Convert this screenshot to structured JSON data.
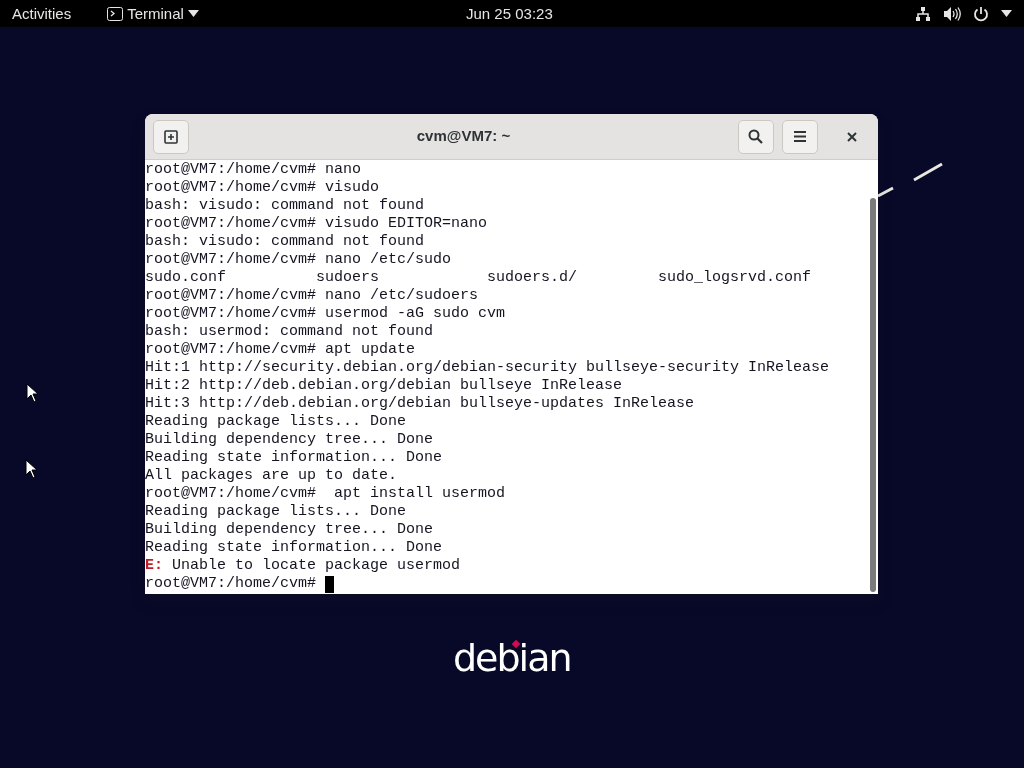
{
  "top_bar": {
    "activities": "Activities",
    "app_menu": "Terminal",
    "clock": "Jun 25  03:23"
  },
  "window": {
    "title": "cvm@VM7: ~",
    "lines": [
      {
        "kind": "text",
        "text": "root@VM7:/home/cvm# nano"
      },
      {
        "kind": "text",
        "text": "root@VM7:/home/cvm# visudo"
      },
      {
        "kind": "text",
        "text": "bash: visudo: command not found"
      },
      {
        "kind": "text",
        "text": "root@VM7:/home/cvm# visudo EDITOR=nano"
      },
      {
        "kind": "text",
        "text": "bash: visudo: command not found"
      },
      {
        "kind": "text",
        "text": "root@VM7:/home/cvm# nano /etc/sudo"
      },
      {
        "kind": "text",
        "text": "sudo.conf          sudoers            sudoers.d/         sudo_logsrvd.conf"
      },
      {
        "kind": "text",
        "text": "root@VM7:/home/cvm# nano /etc/sudoers"
      },
      {
        "kind": "text",
        "text": "root@VM7:/home/cvm# usermod -aG sudo cvm"
      },
      {
        "kind": "text",
        "text": "bash: usermod: command not found"
      },
      {
        "kind": "text",
        "text": "root@VM7:/home/cvm# apt update"
      },
      {
        "kind": "text",
        "text": "Hit:1 http://security.debian.org/debian-security bullseye-security InRelease"
      },
      {
        "kind": "text",
        "text": "Hit:2 http://deb.debian.org/debian bullseye InRelease"
      },
      {
        "kind": "text",
        "text": "Hit:3 http://deb.debian.org/debian bullseye-updates InRelease"
      },
      {
        "kind": "text",
        "text": "Reading package lists... Done"
      },
      {
        "kind": "text",
        "text": "Building dependency tree... Done"
      },
      {
        "kind": "text",
        "text": "Reading state information... Done"
      },
      {
        "kind": "text",
        "text": "All packages are up to date."
      },
      {
        "kind": "text",
        "text": "root@VM7:/home/cvm#  apt install usermod"
      },
      {
        "kind": "text",
        "text": "Reading package lists... Done"
      },
      {
        "kind": "text",
        "text": "Building dependency tree... Done"
      },
      {
        "kind": "text",
        "text": "Reading state information... Done"
      },
      {
        "kind": "error",
        "prefix": "E:",
        "text": " Unable to locate package usermod"
      },
      {
        "kind": "prompt",
        "text": "root@VM7:/home/cvm# ",
        "cursor": true
      }
    ]
  },
  "logo": {
    "text": "debian"
  }
}
